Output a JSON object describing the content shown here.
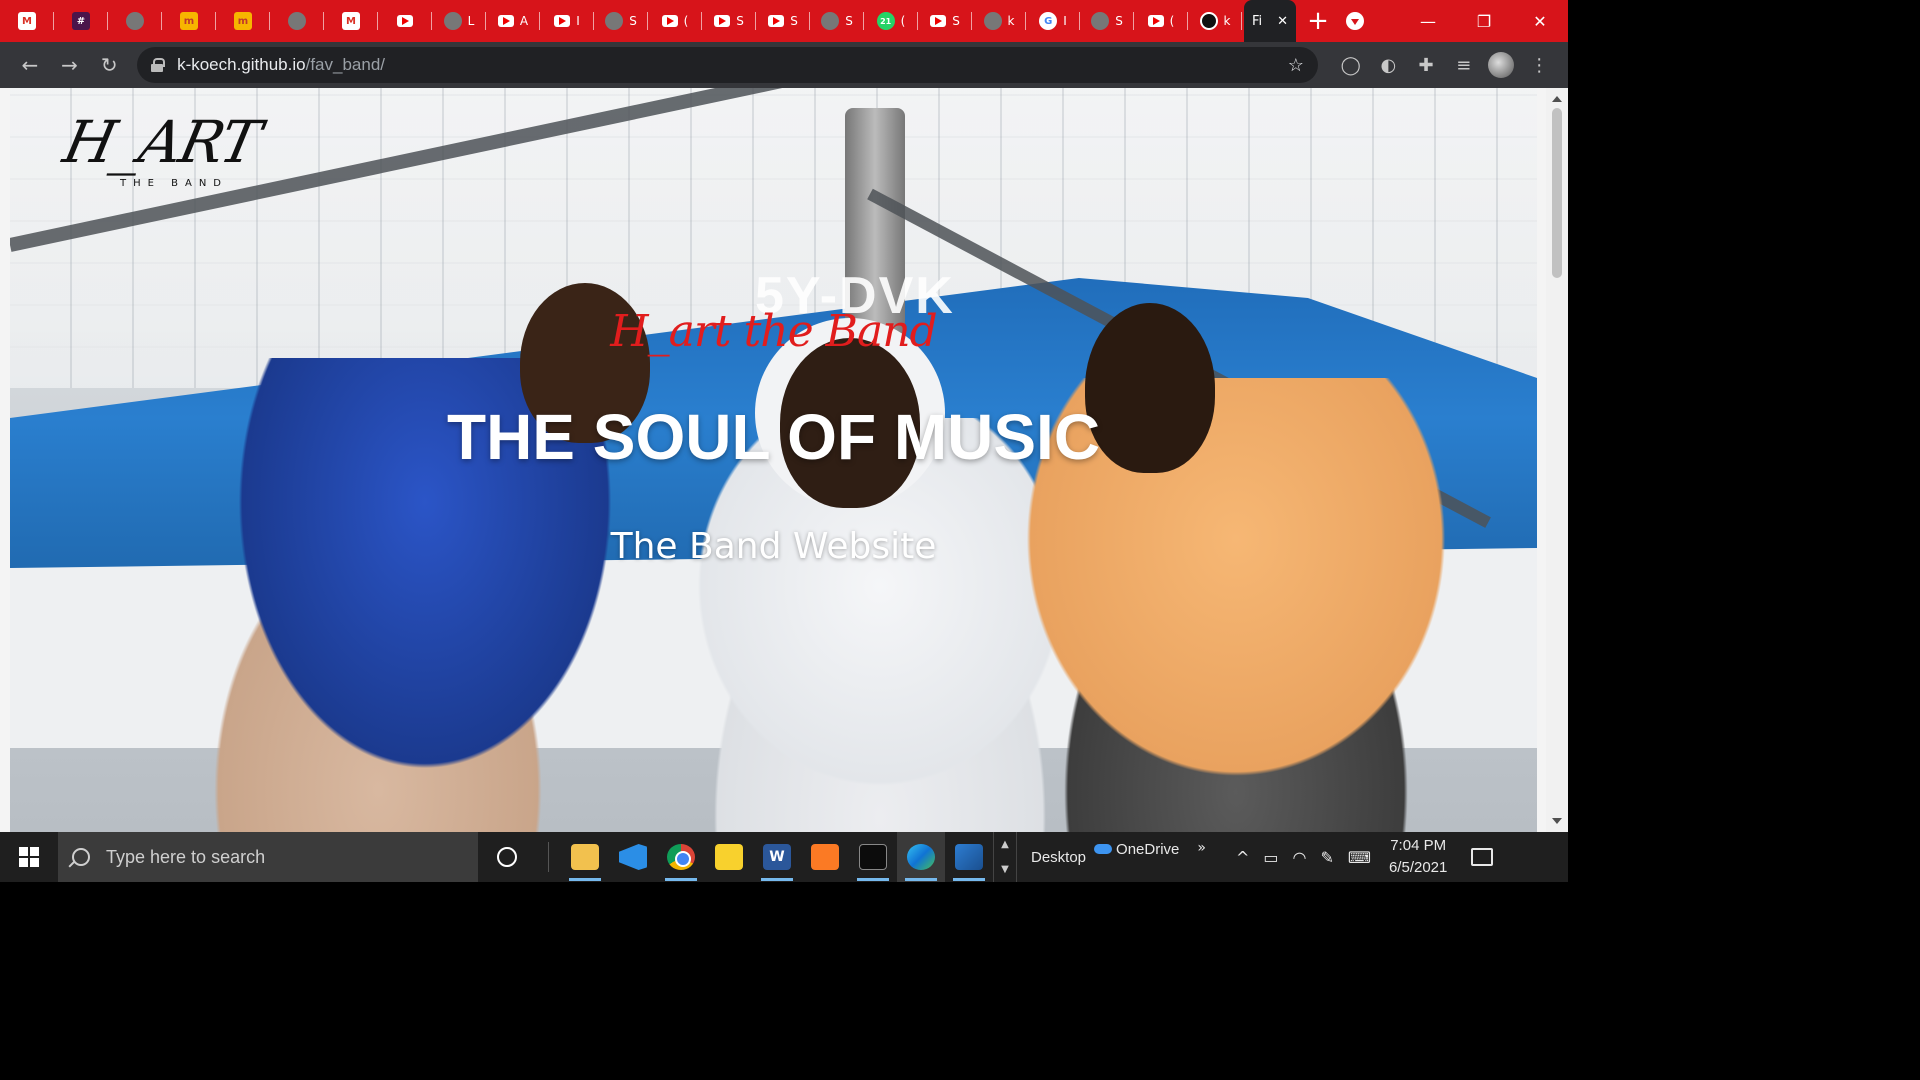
{
  "browser": {
    "tabs": [
      {
        "icon": "gmail-icon",
        "label": "",
        "fav": "gm",
        "glyph": "M"
      },
      {
        "icon": "slack-icon",
        "label": "",
        "fav": "slack",
        "glyph": "#"
      },
      {
        "icon": "pen-app-icon",
        "label": "",
        "fav": "gray",
        "glyph": ""
      },
      {
        "icon": "moringa-icon",
        "label": "",
        "fav": "mn",
        "glyph": "m"
      },
      {
        "icon": "moringa-icon",
        "label": "",
        "fav": "mn",
        "glyph": "m"
      },
      {
        "icon": "codewars-icon",
        "label": "",
        "fav": "gray",
        "glyph": ""
      },
      {
        "icon": "gmail-icon",
        "label": "",
        "fav": "gm",
        "glyph": "M"
      },
      {
        "icon": "youtube-icon",
        "label": "",
        "fav": "yt",
        "glyph": ""
      },
      {
        "icon": "pin-icon",
        "label": "L",
        "fav": "gray",
        "glyph": ""
      },
      {
        "icon": "youtube-icon",
        "label": "A",
        "fav": "yt",
        "glyph": ""
      },
      {
        "icon": "youtube-icon",
        "label": "I",
        "fav": "yt",
        "glyph": ""
      },
      {
        "icon": "globe-icon",
        "label": "S",
        "fav": "gray",
        "glyph": ""
      },
      {
        "icon": "youtube-icon",
        "label": "(",
        "fav": "yt",
        "glyph": ""
      },
      {
        "icon": "youtube-icon",
        "label": "S",
        "fav": "yt",
        "glyph": ""
      },
      {
        "icon": "youtube-icon",
        "label": "S",
        "fav": "yt",
        "glyph": ""
      },
      {
        "icon": "globe-icon",
        "label": "S",
        "fav": "gray",
        "glyph": ""
      },
      {
        "icon": "whatsapp-icon",
        "label": "(",
        "fav": "wa",
        "glyph": "21"
      },
      {
        "icon": "youtube-icon",
        "label": "S",
        "fav": "yt",
        "glyph": ""
      },
      {
        "icon": "tool-icon",
        "label": "k",
        "fav": "gray",
        "glyph": ""
      },
      {
        "icon": "google-icon",
        "label": "I",
        "fav": "g",
        "glyph": "G"
      },
      {
        "icon": "globe-icon",
        "label": "S",
        "fav": "gray",
        "glyph": ""
      },
      {
        "icon": "youtube-icon",
        "label": "(",
        "fav": "yt",
        "glyph": ""
      },
      {
        "icon": "github-icon",
        "label": "k",
        "fav": "gh",
        "glyph": ""
      }
    ],
    "active_tab_label": "Fi",
    "url_host": "k-koech.github.io",
    "url_path": "/fav_band/"
  },
  "page": {
    "logo_main": "H_ART",
    "logo_sub": "THE BAND",
    "script_title": "H_art the Band",
    "headline": "THE SOUL OF MUSIC",
    "subtitle": "The Band Website",
    "photo_plate": "5Y-DVK"
  },
  "taskbar": {
    "search_placeholder": "Type here to search",
    "desktop_label": "Desktop",
    "onedrive_label": "OneDrive",
    "time": "7:04 PM",
    "date": "6/5/2021"
  },
  "colors": {
    "tabstrip": "#d7141a",
    "toolbar": "#35363a",
    "script_title": "#e11d1d"
  }
}
